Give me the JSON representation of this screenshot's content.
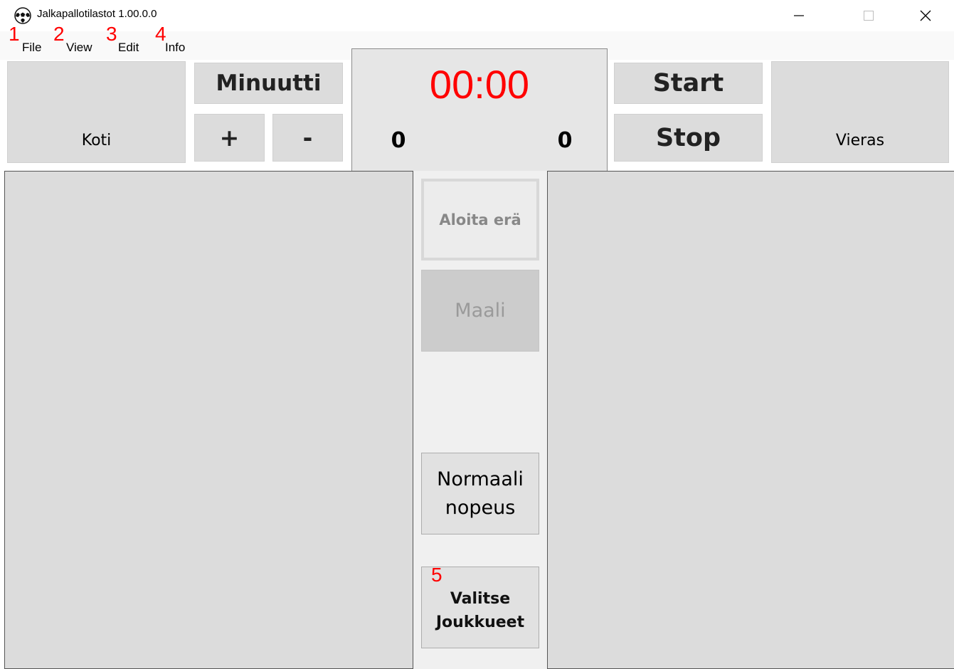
{
  "window": {
    "title": "Jalkapallotilastot 1.00.0.0",
    "icon": "soccer-ball-icon"
  },
  "menu": {
    "items": [
      {
        "label": "File",
        "annotation": "1"
      },
      {
        "label": "View",
        "annotation": "2"
      },
      {
        "label": "Edit",
        "annotation": "3"
      },
      {
        "label": "Info",
        "annotation": "4"
      }
    ]
  },
  "teams": {
    "home_label": "Koti",
    "away_label": "Vieras"
  },
  "controls": {
    "minute_label": "Minuutti",
    "plus_label": "+",
    "minus_label": "-",
    "start_label": "Start",
    "stop_label": "Stop"
  },
  "scoreboard": {
    "clock": "00:00",
    "home_score": "0",
    "away_score": "0"
  },
  "actions": {
    "start_period_label": "Aloita erä",
    "goal_label": "Maali",
    "speed_line1": "Normaali",
    "speed_line2": "nopeus",
    "select_teams_line1": "Valitse",
    "select_teams_line2": "Joukkueet",
    "select_teams_annotation": "5"
  },
  "colors": {
    "clock": "#ff0000",
    "annotation": "#ff0000",
    "panel": "#dcdcdc"
  }
}
